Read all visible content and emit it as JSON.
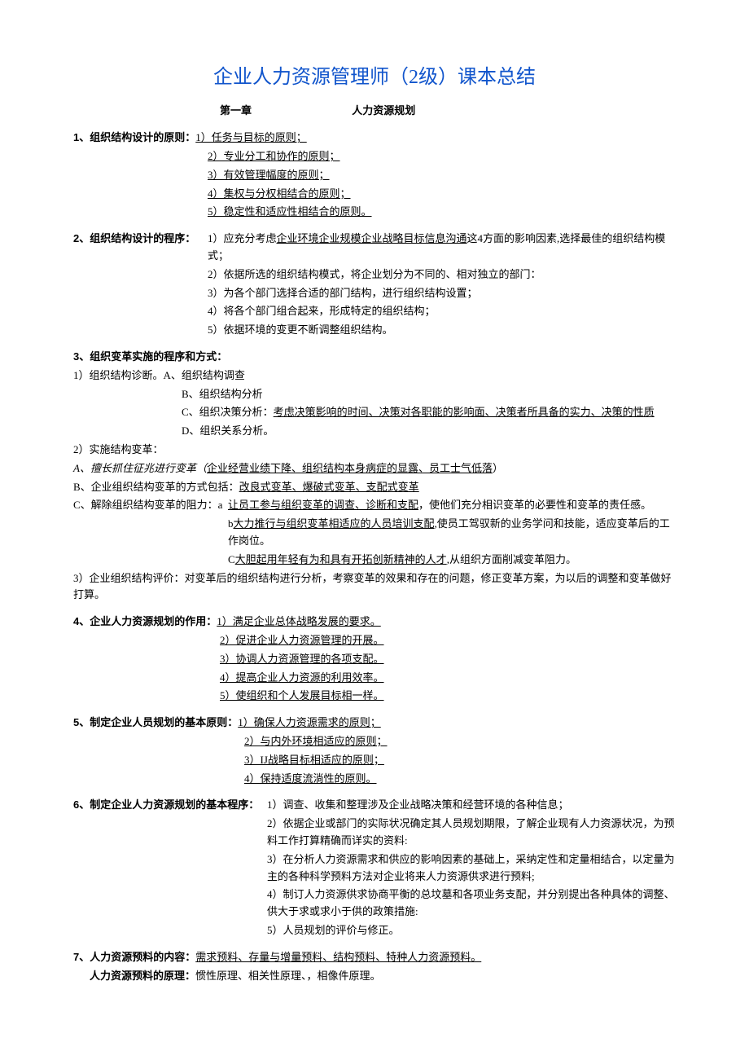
{
  "title": "企业人力资源管理师（2级）课本总结",
  "chapter": {
    "label": "第一章",
    "title": "人力资源规划"
  },
  "s1": {
    "lead": "1、组织结构设计的原则：",
    "i1": "1）任务与目标的原则；",
    "i2": "2）专业分工和协作的原则；",
    "i3": "3）有效管理幅度的原则；",
    "i4": "4）集权与分权相结合的原则；",
    "i5": "5）稳定性和适应性相结合的原则。"
  },
  "s2": {
    "lead": "2、组织结构设计的程序：",
    "i1a": "1）应充分考虑",
    "i1u": "企业环境企业规模企业战略目标信息沟通",
    "i1b": "这4方面的影响因素,选择最佳的组织结构模式；",
    "i2": "2）依据所选的组织结构模式，将企业划分为不同的、相对独立的部门：",
    "i3": "3）为各个部门选择合适的部门结构，进行组织结构设置；",
    "i4": "4）将各个部门组合起来，形成特定的组织结构；",
    "i5": "5）依据环境的变更不断调整组织结构。"
  },
  "s3": {
    "lead": "3、组织变革实施的程序和方式：",
    "p1": "1）组织结构诊断。A、组织结构调查",
    "p1b": "B、组织结构分析",
    "p1c_a": "C、组织决策分析：",
    "p1c_u": "考虑决策影响的时间、决策对各职能的影响面、决策者所具备的实力、决策的性质",
    "p1d": "D、组织关系分析。",
    "p2": "2）实施结构变革：",
    "pA_a": "A、擅长抓住征兆进行变革（",
    "pA_u": "企业经营业绩下降、组织结构本身病症的显露、员工士气低落",
    "pA_b": "）",
    "pB_a": "B、企业组织结构变革的方式包括：",
    "pB_u": "改良式变革、爆破式变革、支配式变革",
    "pC_a": "C、解除组织结构变革的阻力：a",
    "pC_u": "让员工参与组织变革的调查、诊断和支配",
    "pC_b": "，使他们充分相识变革的必要性和变革的责任感。",
    "pC2_a": "b",
    "pC2_u": "大力推行与组织变革相适应的人员培训支配",
    "pC2_b": ",使员工驾驭新的业务学问和技能，适应变革后的工作岗位。",
    "pC3_a": "C",
    "pC3_u": "大胆起用年轻有为和具有开拓创新精神的人才",
    "pC3_b": ",从组织方面削减变革阻力。",
    "p3": "3）企业组织结构评价：对变革后的组织结构进行分析，考察变革的效果和存在的问题，修正变革方案，为以后的调整和变革做好打算。"
  },
  "s4": {
    "lead": "4、企业",
    "leadb": "人力资源规划的作用：",
    "i1": "1）满足企业总体战略发展的要求。",
    "i2": "2）促进企业人力资源管理的开展。",
    "i3": "3）协调人力资源管理的各项支配。",
    "i4": "4）提高企业人力资源的利用效率。",
    "i5": "5）使组织和个人发展目标相一样。"
  },
  "s5": {
    "lead": "5、制定企业人员规划的基本原则：",
    "i1": "1）确保人力资源需求的原则；",
    "i2": "2）与内外环境相适应的原则；",
    "i3": "3）IJ战略目标相适应的原则；",
    "i4": "4）保持适度流淌性的原则。"
  },
  "s6": {
    "lead": "6、制定企业人力资源规划的基本程序：",
    "i1": "1）调查、收集和整理涉及企业战略决策和经营环境的各种信息；",
    "i2": "2）依据企业或部门的实际状况确定其人员规划期限，了解企业现有人力资源状况，为预料工作打算精确而详实的资料:",
    "i3": "3）在分析人力资源需求和供应的影响因素的基础上，采纳定性和定量相结合，以定量为主的各种科学预料方法对企业将来人力资源供求进行预料;",
    "i4": "4）制订人力资源供求协商平衡的总坟墓和各项业务支配，并分别提出各种具体的调整、供大于求或求小于供的政策措施:",
    "i5": "5）人员规划的评价与修正。"
  },
  "s7": {
    "lead": "7、人力资源预料的内容：",
    "u": "需求预料、存量与增量预料、结构预料、特种人力资源预料。",
    "lead2": "人力资源预料的原理：",
    "rest": "惯性原理、相关性原理、，相像件原理。"
  }
}
